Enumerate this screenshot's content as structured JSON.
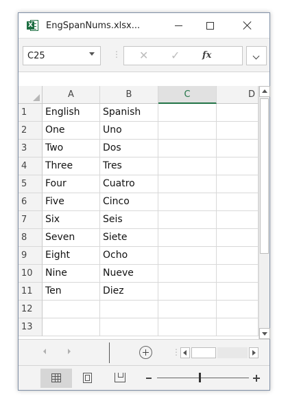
{
  "window": {
    "title": "EngSpanNums.xlsx...",
    "app_icon": "excel-icon",
    "app_icon_letter": "X"
  },
  "formula_bar": {
    "name_box": "C25",
    "cancel_icon": "✕",
    "enter_icon": "✓",
    "fx_label": "fx",
    "separator": "⋮",
    "formula_value": ""
  },
  "columns": [
    "A",
    "B",
    "C",
    "D"
  ],
  "selected_column": "C",
  "rows": [
    {
      "num": "1",
      "cells": [
        "English",
        "Spanish",
        "",
        ""
      ]
    },
    {
      "num": "2",
      "cells": [
        "One",
        "Uno",
        "",
        ""
      ]
    },
    {
      "num": "3",
      "cells": [
        "Two",
        "Dos",
        "",
        ""
      ]
    },
    {
      "num": "4",
      "cells": [
        "Three",
        "Tres",
        "",
        ""
      ]
    },
    {
      "num": "5",
      "cells": [
        "Four",
        "Cuatro",
        "",
        ""
      ]
    },
    {
      "num": "6",
      "cells": [
        "Five",
        "Cinco",
        "",
        ""
      ]
    },
    {
      "num": "7",
      "cells": [
        "Six",
        "Seis",
        "",
        ""
      ]
    },
    {
      "num": "8",
      "cells": [
        "Seven",
        "Siete",
        "",
        ""
      ]
    },
    {
      "num": "9",
      "cells": [
        "Eight",
        "Ocho",
        "",
        ""
      ]
    },
    {
      "num": "10",
      "cells": [
        "Nine",
        "Nueve",
        "",
        ""
      ]
    },
    {
      "num": "11",
      "cells": [
        "Ten",
        "Diez",
        "",
        ""
      ]
    },
    {
      "num": "12",
      "cells": [
        "",
        "",
        "",
        ""
      ]
    },
    {
      "num": "13",
      "cells": [
        "",
        "",
        "",
        ""
      ]
    }
  ],
  "tab_bar": {
    "separator": "⋮"
  },
  "colors": {
    "accent": "#217346",
    "excel_green": "#1d6f42"
  }
}
